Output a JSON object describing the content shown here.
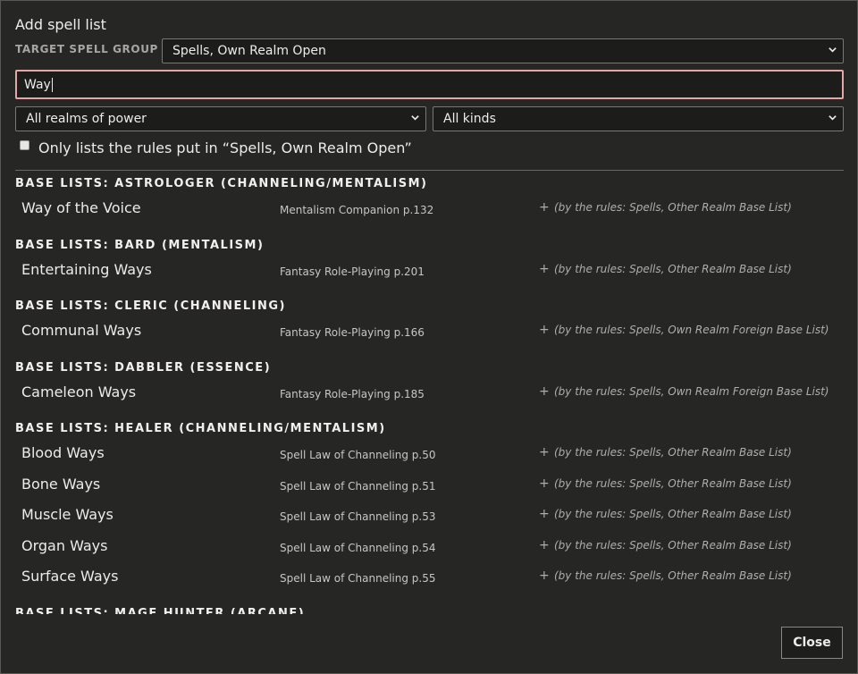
{
  "dialog": {
    "title": "Add spell list",
    "target_label": "TARGET SPELL GROUP",
    "target_value": "Spells, Own Realm Open",
    "search_value": "Way",
    "realm_filter": "All realms of power",
    "kind_filter": "All kinds",
    "only_label": "Only lists the rules put in “Spells, Own Realm Open”",
    "only_checked": false,
    "close_label": "Close"
  },
  "groups": [
    {
      "title": "BASE LISTS: ASTROLOGER (CHANNELING/MENTALISM)",
      "entries": [
        {
          "name": "Way of the Voice",
          "source": "Mentalism Companion p.132",
          "add": "+",
          "rule": "(by the rules: Spells, Other Realm Base List)"
        }
      ]
    },
    {
      "title": "BASE LISTS: BARD (MENTALISM)",
      "entries": [
        {
          "name": "Entertaining Ways",
          "source": "Fantasy Role-Playing p.201",
          "add": "+",
          "rule": "(by the rules: Spells, Other Realm Base List)"
        }
      ]
    },
    {
      "title": "BASE LISTS: CLERIC (CHANNELING)",
      "entries": [
        {
          "name": "Communal Ways",
          "source": "Fantasy Role-Playing p.166",
          "add": "+",
          "rule": "(by the rules: Spells, Own Realm Foreign Base List)"
        }
      ]
    },
    {
      "title": "BASE LISTS: DABBLER (ESSENCE)",
      "entries": [
        {
          "name": "Cameleon Ways",
          "source": "Fantasy Role-Playing p.185",
          "add": "+",
          "rule": "(by the rules: Spells, Own Realm Foreign Base List)"
        }
      ]
    },
    {
      "title": "BASE LISTS: HEALER (CHANNELING/MENTALISM)",
      "entries": [
        {
          "name": "Blood Ways",
          "source": "Spell Law of Channeling p.50",
          "add": "+",
          "rule": "(by the rules: Spells, Other Realm Base List)"
        },
        {
          "name": "Bone Ways",
          "source": "Spell Law of Channeling p.51",
          "add": "+",
          "rule": "(by the rules: Spells, Other Realm Base List)"
        },
        {
          "name": "Muscle Ways",
          "source": "Spell Law of Channeling p.53",
          "add": "+",
          "rule": "(by the rules: Spells, Other Realm Base List)"
        },
        {
          "name": "Organ Ways",
          "source": "Spell Law of Channeling p.54",
          "add": "+",
          "rule": "(by the rules: Spells, Other Realm Base List)"
        },
        {
          "name": "Surface Ways",
          "source": "Spell Law of Channeling p.55",
          "add": "+",
          "rule": "(by the rules: Spells, Other Realm Base List)"
        }
      ]
    },
    {
      "title": "BASE LISTS: MAGE HUNTER (ARCANE)",
      "entries": []
    }
  ]
}
